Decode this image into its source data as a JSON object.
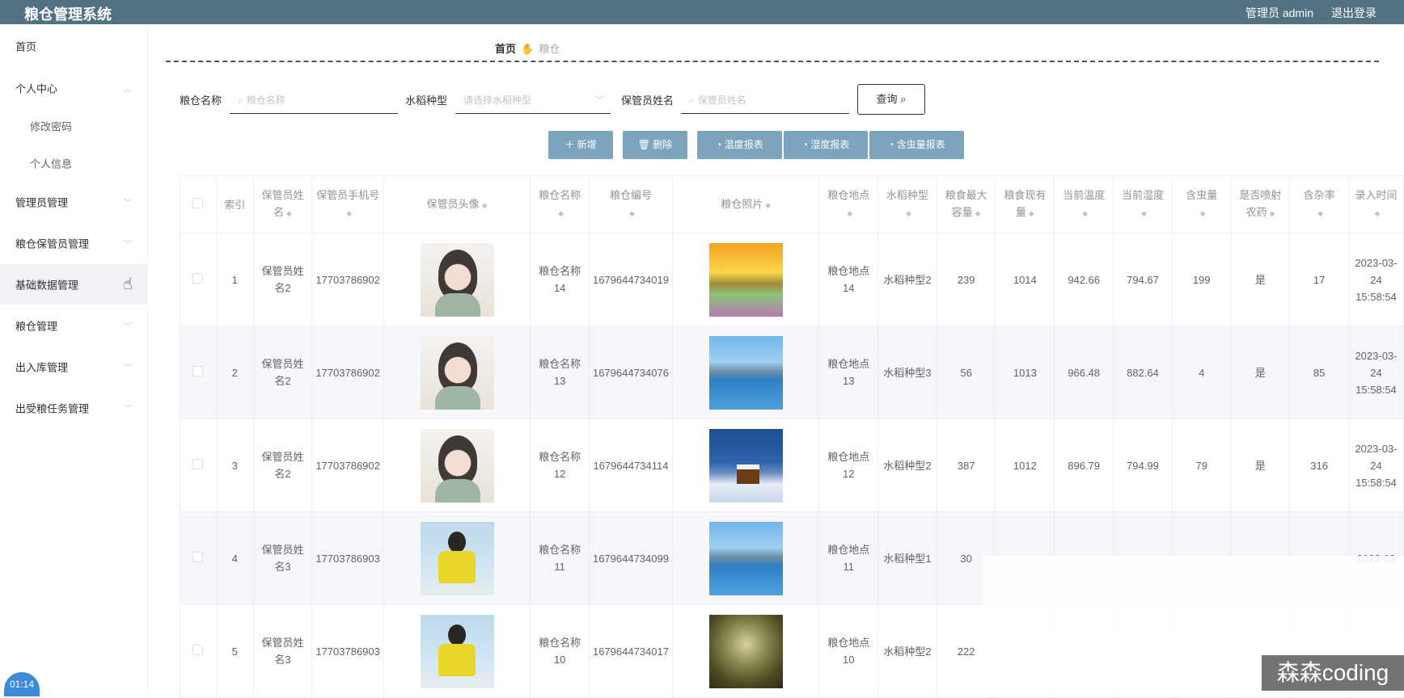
{
  "header": {
    "title": "粮仓管理系统",
    "user": "管理员 admin",
    "logout": "退出登录"
  },
  "sidebar": {
    "items": [
      {
        "label": "首页"
      },
      {
        "label": "个人中心"
      },
      {
        "label": "修改密码"
      },
      {
        "label": "个人信息"
      },
      {
        "label": "管理员管理"
      },
      {
        "label": "粮仓保管员管理"
      },
      {
        "label": "基础数据管理"
      },
      {
        "label": "粮仓管理"
      },
      {
        "label": "出入库管理"
      },
      {
        "label": "出受粮任务管理"
      }
    ],
    "timer": "01:14"
  },
  "breadcrumb": {
    "home": "首页",
    "current": "粮仓"
  },
  "search": {
    "name_label": "粮仓名称",
    "name_placeholder": "粮仓名称",
    "rice_label": "水稻种型",
    "rice_placeholder": "请选择水稻种型",
    "keeper_label": "保管员姓名",
    "keeper_placeholder": "保管员姓名",
    "query": "查询"
  },
  "actions": {
    "add": "新增",
    "delete": "删除",
    "temp_report": "温度报表",
    "humidity_report": "湿度报表",
    "insect_report": "含虫量报表"
  },
  "table": {
    "headers": {
      "index": "索引",
      "keeper_name": "保管员姓名",
      "keeper_phone": "保管员手机号",
      "keeper_avatar": "保管员头像",
      "granary_name": "粮仓名称",
      "granary_code": "粮仓编号",
      "granary_photo": "粮仓照片",
      "granary_location": "粮仓地点",
      "rice_type": "水稻种型",
      "max_capacity": "粮食最大容量",
      "current_stock": "粮食现有量",
      "current_temp": "当前温度",
      "current_humidity": "当前湿度",
      "insect": "含虫量",
      "pesticide": "是否喷射农药",
      "impurity": "含杂率",
      "entry_time": "录入时间"
    },
    "rows": [
      {
        "index": "1",
        "keeper_name": "保管员姓名2",
        "keeper_phone": "17703786902",
        "granary_name": "粮仓名称14",
        "granary_code": "1679644734019",
        "granary_location": "粮仓地点14",
        "rice_type": "水稻种型2",
        "max_capacity": "239",
        "current_stock": "1014",
        "current_temp": "942.66",
        "current_humidity": "794.67",
        "insect": "199",
        "pesticide": "是",
        "impurity": "17",
        "entry_time": "2023-03-24 15:58:54"
      },
      {
        "index": "2",
        "keeper_name": "保管员姓名2",
        "keeper_phone": "17703786902",
        "granary_name": "粮仓名称13",
        "granary_code": "1679644734076",
        "granary_location": "粮仓地点13",
        "rice_type": "水稻种型3",
        "max_capacity": "56",
        "current_stock": "1013",
        "current_temp": "966.48",
        "current_humidity": "882.64",
        "insect": "4",
        "pesticide": "是",
        "impurity": "85",
        "entry_time": "2023-03-24 15:58:54"
      },
      {
        "index": "3",
        "keeper_name": "保管员姓名2",
        "keeper_phone": "17703786902",
        "granary_name": "粮仓名称12",
        "granary_code": "1679644734114",
        "granary_location": "粮仓地点12",
        "rice_type": "水稻种型2",
        "max_capacity": "387",
        "current_stock": "1012",
        "current_temp": "896.79",
        "current_humidity": "794.99",
        "insect": "79",
        "pesticide": "是",
        "impurity": "316",
        "entry_time": "2023-03-24 15:58:54"
      },
      {
        "index": "4",
        "keeper_name": "保管员姓名3",
        "keeper_phone": "17703786903",
        "granary_name": "粮仓名称11",
        "granary_code": "1679644734099",
        "granary_location": "粮仓地点11",
        "rice_type": "水稻种型1",
        "max_capacity": "30",
        "current_stock": "",
        "current_temp": "",
        "current_humidity": "",
        "insect": "",
        "pesticide": "",
        "impurity": "",
        "entry_time": "2023-03"
      },
      {
        "index": "5",
        "keeper_name": "保管员姓名3",
        "keeper_phone": "17703786903",
        "granary_name": "粮仓名称10",
        "granary_code": "1679644734017",
        "granary_location": "粮仓地点10",
        "rice_type": "水稻种型2",
        "max_capacity": "222",
        "current_stock": "",
        "current_temp": "",
        "current_humidity": "",
        "insect": "",
        "pesticide": "",
        "impurity": "",
        "entry_time": ""
      }
    ]
  },
  "watermark": "森森coding"
}
